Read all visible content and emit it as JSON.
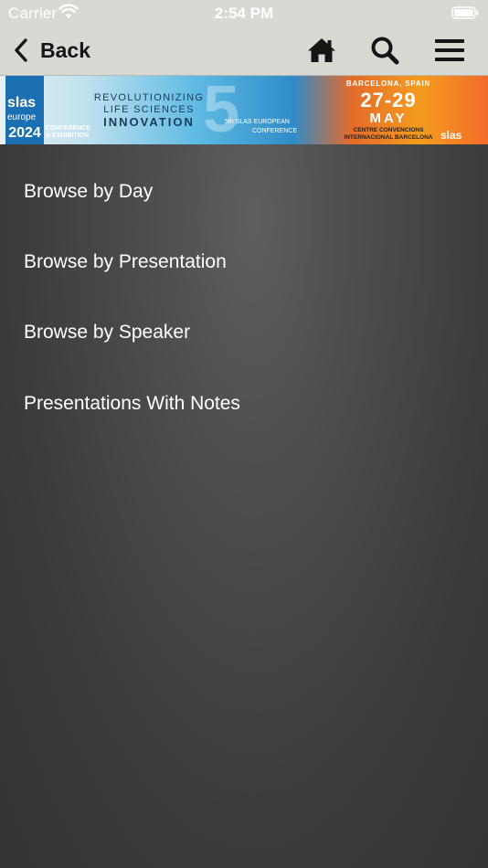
{
  "status_bar": {
    "carrier": "Carrier",
    "time": "2:54 PM",
    "wifi_icon": "wifi-icon",
    "battery_icon": "battery-icon"
  },
  "nav": {
    "back_label": "Back",
    "icons": [
      "chevron-left-icon",
      "home-icon",
      "search-icon",
      "hamburger-menu-icon"
    ]
  },
  "banner": {
    "logo_slas": "slas",
    "logo_europe": "europe",
    "logo_year": "2024",
    "logo_conference_line1": "CONFERENCE",
    "logo_conference_line2": "& EXHIBITION",
    "tagline_line1": "REVOLUTIONIZING",
    "tagline_line2": "LIFE SCIENCES",
    "tagline_line3": "INNOVATION",
    "edition_number": "5",
    "edition_line1": "5th SLAS EUROPEAN",
    "edition_line2": "CONFERENCE",
    "city": "BARCELONA, SPAIN",
    "dates": "27-29",
    "month": "MAY",
    "venue_line1": "CENTRE CONVENCIONS",
    "venue_line2": "INTERNACIONAL BARCELONA",
    "brand": "slas"
  },
  "menu": {
    "items": [
      "Browse by Day",
      "Browse by Presentation",
      "Browse by Speaker",
      "Presentations With Notes"
    ]
  },
  "colors": {
    "nav_background": "#d9d9d4",
    "content_background": "#3c3c3c",
    "menu_text": "#ffffff"
  }
}
